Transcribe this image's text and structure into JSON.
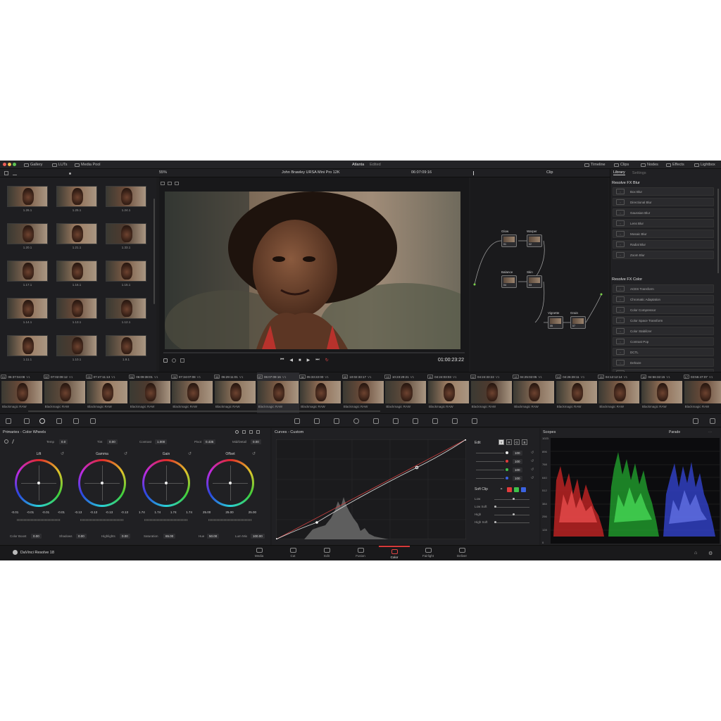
{
  "topbar": {
    "left_items": [
      {
        "label": "Gallery",
        "icon": "gallery-icon"
      },
      {
        "label": "LUTs",
        "icon": "luts-icon"
      },
      {
        "label": "Media Pool",
        "icon": "media-pool-icon"
      }
    ],
    "project_name": "Atlanta",
    "project_status": "Edited",
    "right_items": [
      {
        "label": "Timeline",
        "icon": "timeline-icon"
      },
      {
        "label": "Clips",
        "icon": "clips-icon"
      },
      {
        "label": "Nodes",
        "icon": "nodes-icon"
      },
      {
        "label": "Effects",
        "icon": "effects-icon"
      },
      {
        "label": "Lightbox",
        "icon": "lightbox-icon"
      }
    ],
    "traffic_colors": [
      "#ec5f57",
      "#f4bd4f",
      "#5fc453"
    ]
  },
  "viewer": {
    "zoom": "55%",
    "clip_name": "John Brawley URSA Mini Pro 12K",
    "source_timecode": "06:07:09:16",
    "record_timecode": "01:00:23:22"
  },
  "nodes_panel": {
    "mode": "Clip",
    "nodes": [
      {
        "title": "Glow",
        "num": "01"
      },
      {
        "title": "Warper",
        "num": "02"
      },
      {
        "title": "Balance",
        "num": "04"
      },
      {
        "title": "Skin",
        "num": "03"
      },
      {
        "title": "Vignette",
        "num": "05"
      },
      {
        "title": "Grain",
        "num": "07"
      }
    ]
  },
  "library": {
    "tabs": [
      "Library",
      "Settings"
    ],
    "sections": [
      {
        "title": "Resolve FX Blur",
        "items": [
          "Box Blur",
          "Directional Blur",
          "Gaussian Blur",
          "Lens Blur",
          "Mosaic Blur",
          "Radial Blur",
          "Zoom Blur"
        ]
      },
      {
        "title": "Resolve FX Color",
        "items": [
          "ACES Transform",
          "Chromatic Adaptation",
          "Color Compressor",
          "Color Space Transform",
          "Color Stabilizer",
          "Contrast Pop",
          "DCTL",
          "Dehaze",
          "False Color"
        ]
      }
    ]
  },
  "gallery": {
    "stills": [
      "1.26.1",
      "1.25.1",
      "1.24.1",
      "1.20.1",
      "1.21.1",
      "1.33.1",
      "1.17.1",
      "1.16.1",
      "1.15.1",
      "1.14.1",
      "1.13.1",
      "1.12.1",
      "1.11.1",
      "1.10.1",
      "1.9.1"
    ]
  },
  "clips": [
    {
      "num": "01",
      "tc": "06:37:04:08",
      "track": "V1",
      "label": "Blackmagic RAW"
    },
    {
      "num": "02",
      "tc": "07:02:09:12",
      "track": "V1",
      "label": "Blackmagic RAW"
    },
    {
      "num": "03",
      "tc": "07:47:11:13",
      "track": "V1",
      "label": "Blackmagic RAW"
    },
    {
      "num": "04",
      "tc": "06:09:38:01",
      "track": "V1",
      "label": "Blackmagic RAW"
    },
    {
      "num": "05",
      "tc": "07:34:07:08",
      "track": "V1",
      "label": "Blackmagic RAW"
    },
    {
      "num": "06",
      "tc": "06:29:11:01",
      "track": "V1",
      "label": "Blackmagic RAW"
    },
    {
      "num": "07",
      "tc": "06:07:09:16",
      "track": "V1",
      "label": "Blackmagic RAW"
    },
    {
      "num": "08",
      "tc": "05:33:22:00",
      "track": "V1",
      "label": "Blackmagic RAW"
    },
    {
      "num": "09",
      "tc": "10:02:33:17",
      "track": "V1",
      "label": "Blackmagic RAW"
    },
    {
      "num": "10",
      "tc": "10:23:29:21",
      "track": "V1",
      "label": "Blackmagic RAW"
    },
    {
      "num": "11",
      "tc": "04:24:03:03",
      "track": "V1",
      "label": "Blackmagic RAW"
    },
    {
      "num": "12",
      "tc": "04:24:33:22",
      "track": "V1",
      "label": "Blackmagic RAW"
    },
    {
      "num": "13",
      "tc": "04:25:02:05",
      "track": "V1",
      "label": "Blackmagic RAW"
    },
    {
      "num": "14",
      "tc": "04:26:28:11",
      "track": "V1",
      "label": "Blackmagic RAW"
    },
    {
      "num": "15",
      "tc": "04:12:12:14",
      "track": "V1",
      "label": "Blackmagic RAW"
    },
    {
      "num": "16",
      "tc": "04:56:32:15",
      "track": "V1",
      "label": "Blackmagic RAW"
    },
    {
      "num": "17",
      "tc": "03:55:47:07",
      "track": "V1",
      "label": "Blackmagic RAW"
    }
  ],
  "primaries": {
    "title": "Primaries - Color Wheels",
    "top_controls": [
      {
        "label": "Temp",
        "value": "0.0"
      },
      {
        "label": "Tint",
        "value": "0.00"
      },
      {
        "label": "Contrast",
        "value": "1.000"
      },
      {
        "label": "Pivot",
        "value": "0.435"
      },
      {
        "label": "Mid/Detail",
        "value": "0.00"
      }
    ],
    "wheels": [
      {
        "name": "Lift",
        "values": [
          "-0.01",
          "-0.01",
          "-0.01",
          "-0.01"
        ]
      },
      {
        "name": "Gamma",
        "values": [
          "-0.13",
          "-0.13",
          "-0.13",
          "-0.13"
        ]
      },
      {
        "name": "Gain",
        "values": [
          "1.74",
          "1.74",
          "1.74",
          "1.74"
        ]
      },
      {
        "name": "Offset",
        "values": [
          "25.00",
          "25.00",
          "25.00"
        ]
      }
    ],
    "bottom_controls": [
      {
        "label": "Color Boost",
        "value": "0.00"
      },
      {
        "label": "Shadows",
        "value": "0.00"
      },
      {
        "label": "Highlights",
        "value": "0.00"
      },
      {
        "label": "Saturation",
        "value": "65.00"
      },
      {
        "label": "Hue",
        "value": "50.00"
      },
      {
        "label": "Lum Mix",
        "value": "100.00"
      }
    ]
  },
  "curves": {
    "title": "Curves - Custom",
    "edit_label": "Edit",
    "channel_buttons": [
      "Y",
      "R",
      "G",
      "B"
    ],
    "channel_values": [
      "100",
      "100",
      "100",
      "100"
    ],
    "channel_colors": [
      "#e8e8e8",
      "#e23b3b",
      "#3fc24a",
      "#3b63e2"
    ],
    "soft_clip_label": "Soft Clip",
    "soft_clip_rows": [
      "Low",
      "Low Soft",
      "High",
      "High Soft"
    ]
  },
  "scopes": {
    "title": "Scopes",
    "mode": "Parade",
    "scale": [
      "1023",
      "896",
      "768",
      "640",
      "512",
      "384",
      "256",
      "128",
      "0"
    ]
  },
  "footer": {
    "app_name": "DaVinci Resolve 18",
    "pages": [
      {
        "label": "Media",
        "active": false
      },
      {
        "label": "Cut",
        "active": false
      },
      {
        "label": "Edit",
        "active": false
      },
      {
        "label": "Fusion",
        "active": false
      },
      {
        "label": "Color",
        "active": true
      },
      {
        "label": "Fairlight",
        "active": false
      },
      {
        "label": "Deliver",
        "active": false
      }
    ]
  }
}
